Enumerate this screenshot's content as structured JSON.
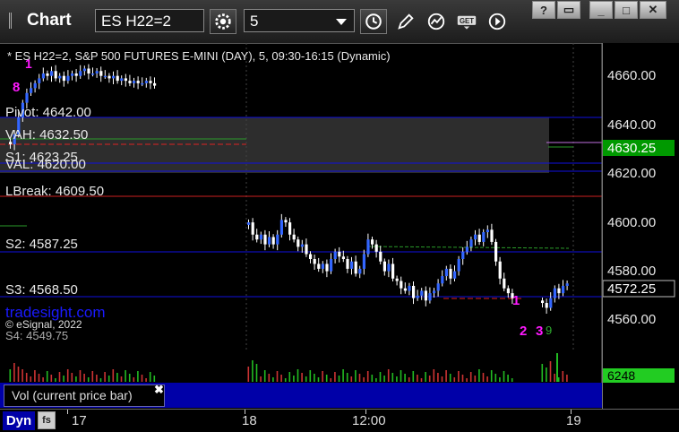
{
  "app": {
    "title": "Chart"
  },
  "toolbar": {
    "symbol": "ES H22=2",
    "interval": "5",
    "icons": [
      "settings-icon",
      "clock-icon",
      "pencil-icon",
      "studies-icon",
      "get-icon",
      "play-icon"
    ]
  },
  "window_controls": [
    "?",
    "▭",
    "_",
    "□",
    "✕"
  ],
  "chart": {
    "header": "* ES H22=2, S&P 500 FUTURES E-MINI (DAY), 5, 09:30-16:15 (Dynamic)",
    "watermark": "tradesight.com",
    "copyright": "© eSignal, 2022",
    "price_axis": [
      "4660.00",
      "4640.00",
      "4620.00",
      "4600.00",
      "4580.00",
      "4560.00"
    ],
    "last_price": "4572.25",
    "green_price": "4630.25",
    "levels": {
      "pivot": "Pivot: 4642.00",
      "vah": "VAH: 4632.50",
      "s1": "S1: 4623.25",
      "val": "VAL: 4620.00",
      "lbreak": "LBreak: 4609.50",
      "s2": "S2: 4587.25",
      "s3": "S3: 4568.50",
      "s4": "S4: 4549.75"
    },
    "markers": {
      "m1": "1",
      "m8": "8",
      "m1b": "1",
      "m2": "2",
      "m3": "3",
      "m9": "9"
    }
  },
  "volume": {
    "label": "Vol (current price bar)",
    "value": "6248",
    "close": "✖"
  },
  "xaxis": {
    "dyn": "Dyn",
    "ticks": [
      "17",
      "18",
      "12:00",
      "19"
    ]
  },
  "colors": {
    "candle": "#3366ff",
    "wick": "#ffffff",
    "axis_green": "#00aa00",
    "level_blue": "#1010e0",
    "lbreak_red": "#cc2020",
    "magenta": "#ff1aff",
    "seq_green": "#2eaa2e"
  },
  "chart_data": {
    "type": "candlestick",
    "y_range": [
      4553,
      4669
    ],
    "y_ticks": [
      4660,
      4640,
      4620,
      4600,
      4580,
      4560
    ],
    "sessions": [
      {
        "name": "17",
        "closes": [
          4629,
          4633,
          4640,
          4646,
          4650,
          4652,
          4654,
          4656,
          4658,
          4657,
          4659,
          4656,
          4657,
          4655,
          4657,
          4658,
          4657,
          4659,
          4660,
          4658,
          4658,
          4659,
          4657,
          4657,
          4656,
          4657,
          4655,
          4656,
          4655,
          4654,
          4655,
          4654,
          4654,
          4655,
          4654,
          4653
        ]
      },
      {
        "name": "18",
        "closes": [
          4597,
          4592,
          4590,
          4592,
          4588,
          4591,
          4588,
          4592,
          4598,
          4597,
          4592,
          4590,
          4587,
          4588,
          4584,
          4582,
          4580,
          4578,
          4580,
          4577,
          4582,
          4585,
          4583,
          4582,
          4578,
          4581,
          4576,
          4578,
          4584,
          4590,
          4588,
          4585,
          4581,
          4577,
          4580,
          4574,
          4573,
          4570,
          4569,
          4571,
          4566,
          4567,
          4569,
          4565,
          4568,
          4569,
          4572,
          4575,
          4578,
          4574,
          4577,
          4582,
          4585,
          4587,
          4590,
          4592,
          4589,
          4593,
          4594,
          4589,
          4581,
          4574,
          4570,
          4568,
          4566
        ]
      },
      {
        "name": "19",
        "closes": [
          4564,
          4562,
          4566,
          4570,
          4568,
          4571,
          4572
        ]
      }
    ],
    "volume_value": 6248
  }
}
